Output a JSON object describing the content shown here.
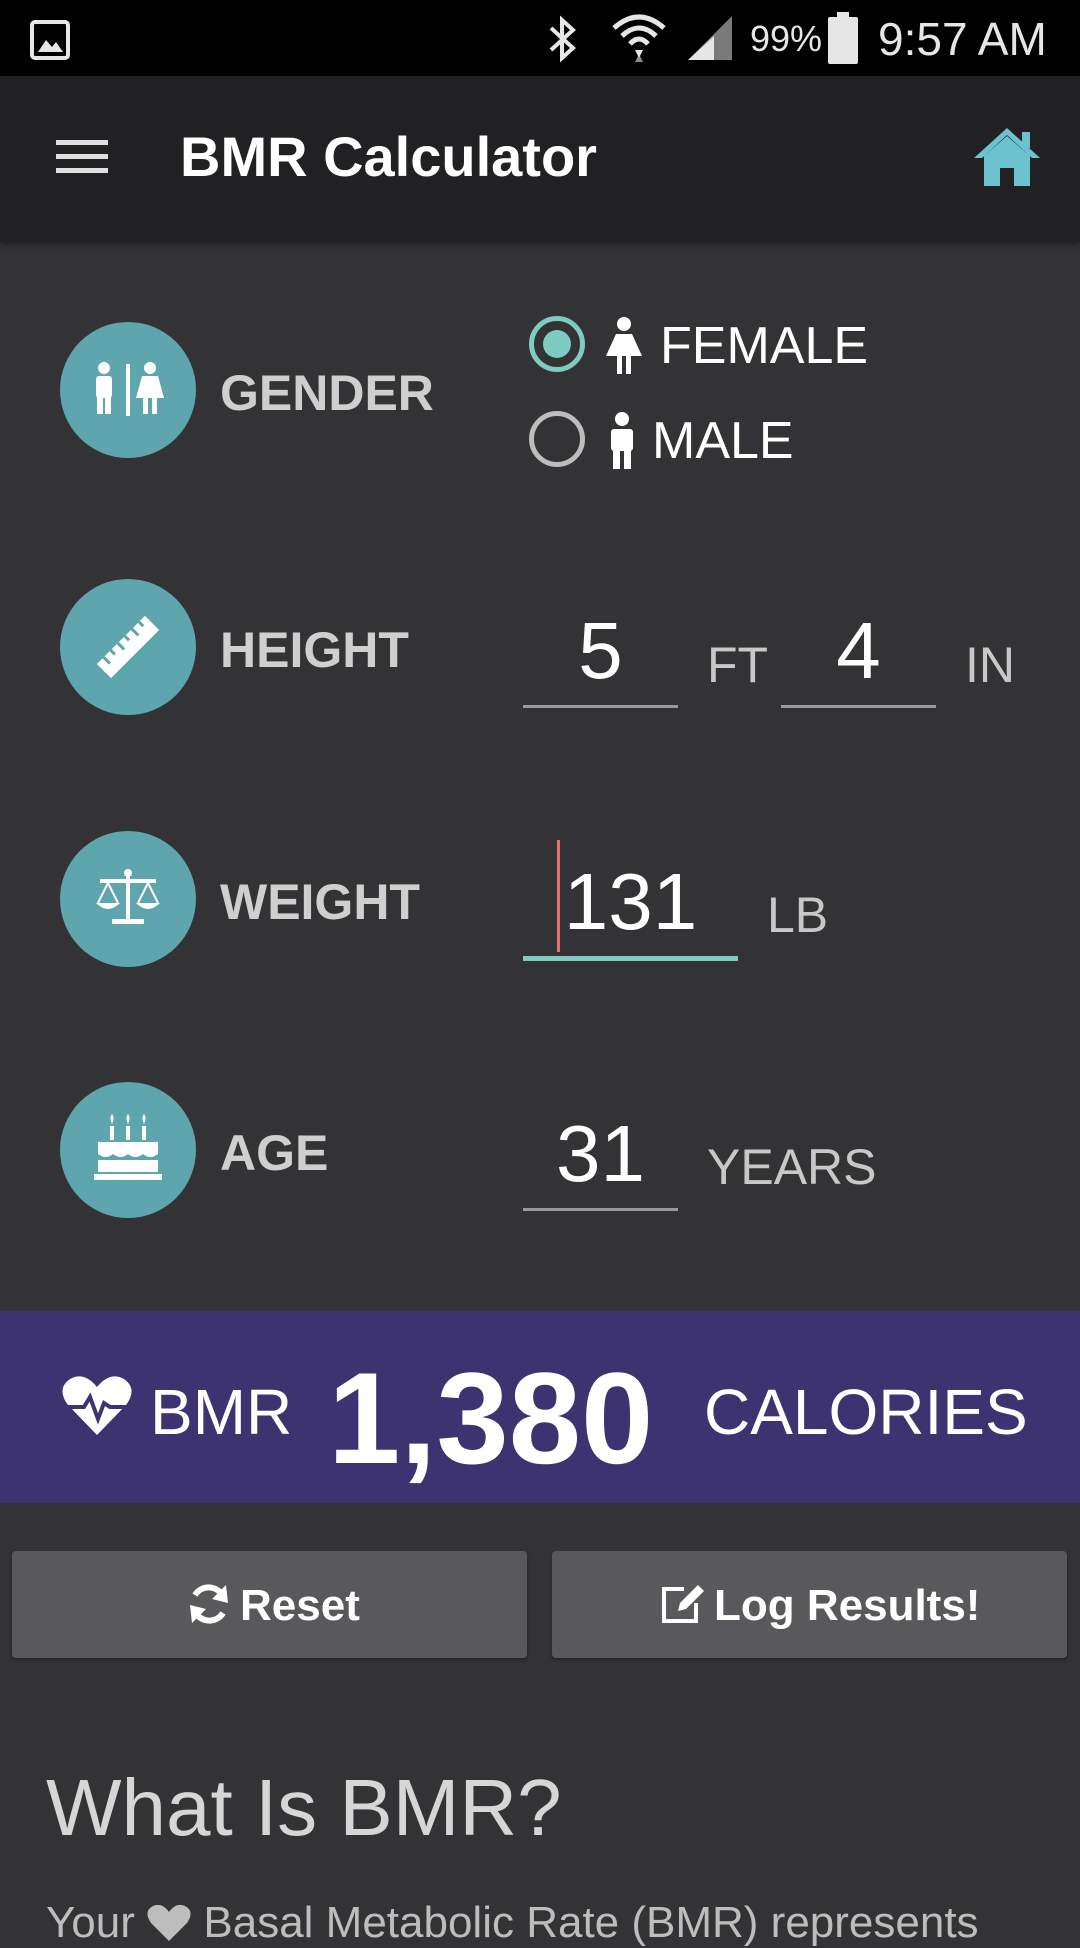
{
  "status_bar": {
    "battery": "99%",
    "time": "9:57 AM",
    "icons": [
      "gallery-icon",
      "bluetooth-icon",
      "wifi-icon",
      "signal-icon",
      "battery-icon"
    ]
  },
  "app_bar": {
    "title": "BMR Calculator",
    "icons": [
      "menu-icon",
      "home-icon"
    ]
  },
  "form": {
    "gender": {
      "label": "GENDER",
      "options": [
        {
          "label": "FEMALE",
          "selected": true
        },
        {
          "label": "MALE",
          "selected": false
        }
      ]
    },
    "height": {
      "label": "HEIGHT",
      "feet": "5",
      "feet_unit": "FT",
      "inches": "4",
      "inches_unit": "IN"
    },
    "weight": {
      "label": "WEIGHT",
      "value": "131",
      "unit": "LB"
    },
    "age": {
      "label": "AGE",
      "value": "31",
      "unit": "YEARS"
    }
  },
  "result": {
    "label": "BMR",
    "value": "1,380",
    "unit": "CALORIES"
  },
  "buttons": {
    "reset": "Reset",
    "log": "Log Results!"
  },
  "info": {
    "title": "What Is BMR?",
    "body_start": "Your",
    "body_rest": "Basal Metabolic Rate (BMR) represents"
  },
  "colors": {
    "accent": "#7ecbc2",
    "icon_circle": "#5fa5ad",
    "result_banner": "#3d3370",
    "home_icon": "#6cc3cf"
  }
}
